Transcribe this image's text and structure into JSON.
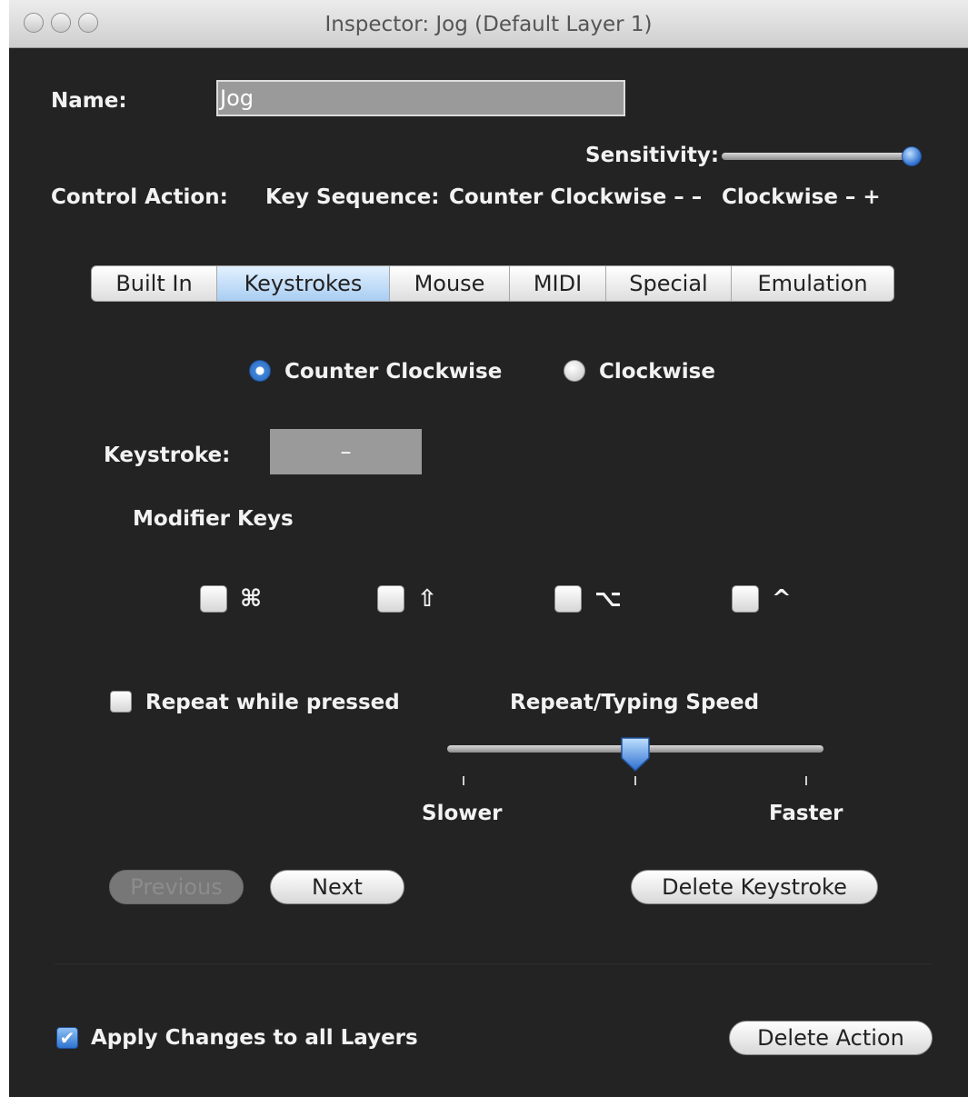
{
  "window": {
    "title": "Inspector: Jog (Default Layer 1)"
  },
  "name": {
    "label": "Name:",
    "value": "Jog"
  },
  "sensitivity": {
    "label": "Sensitivity:",
    "level": 1.0
  },
  "control_action": {
    "label": "Control Action:",
    "key_sequence_label": "Key Sequence:",
    "counter_clockwise": "Counter Clockwise – –",
    "clockwise": "Clockwise – +"
  },
  "tabs": [
    {
      "label": "Built In",
      "active": false
    },
    {
      "label": "Keystrokes",
      "active": true
    },
    {
      "label": "Mouse",
      "active": false
    },
    {
      "label": "MIDI",
      "active": false
    },
    {
      "label": "Special",
      "active": false
    },
    {
      "label": "Emulation",
      "active": false
    }
  ],
  "direction": {
    "options": [
      "Counter Clockwise",
      "Clockwise"
    ],
    "selected": "Counter Clockwise"
  },
  "keystroke": {
    "label": "Keystroke:",
    "value": "–"
  },
  "modifiers": {
    "label": "Modifier Keys",
    "keys": [
      {
        "symbol": "⌘",
        "checked": false
      },
      {
        "symbol": "⇧",
        "checked": false
      },
      {
        "symbol": "⌥",
        "checked": false
      },
      {
        "symbol": "^",
        "checked": false
      }
    ]
  },
  "repeat": {
    "label": "Repeat while pressed",
    "checked": false
  },
  "speed": {
    "label": "Repeat/Typing Speed",
    "slower": "Slower",
    "faster": "Faster",
    "level": 0.5
  },
  "buttons": {
    "previous": "Previous",
    "next": "Next",
    "delete_keystroke": "Delete Keystroke",
    "delete_action": "Delete Action"
  },
  "apply_all": {
    "label": "Apply Changes to all Layers",
    "checked": true,
    "check_glyph": "✔"
  },
  "colors": {
    "background": "#232323",
    "accent": "#3f86d8",
    "text": "#f2f2f2"
  }
}
